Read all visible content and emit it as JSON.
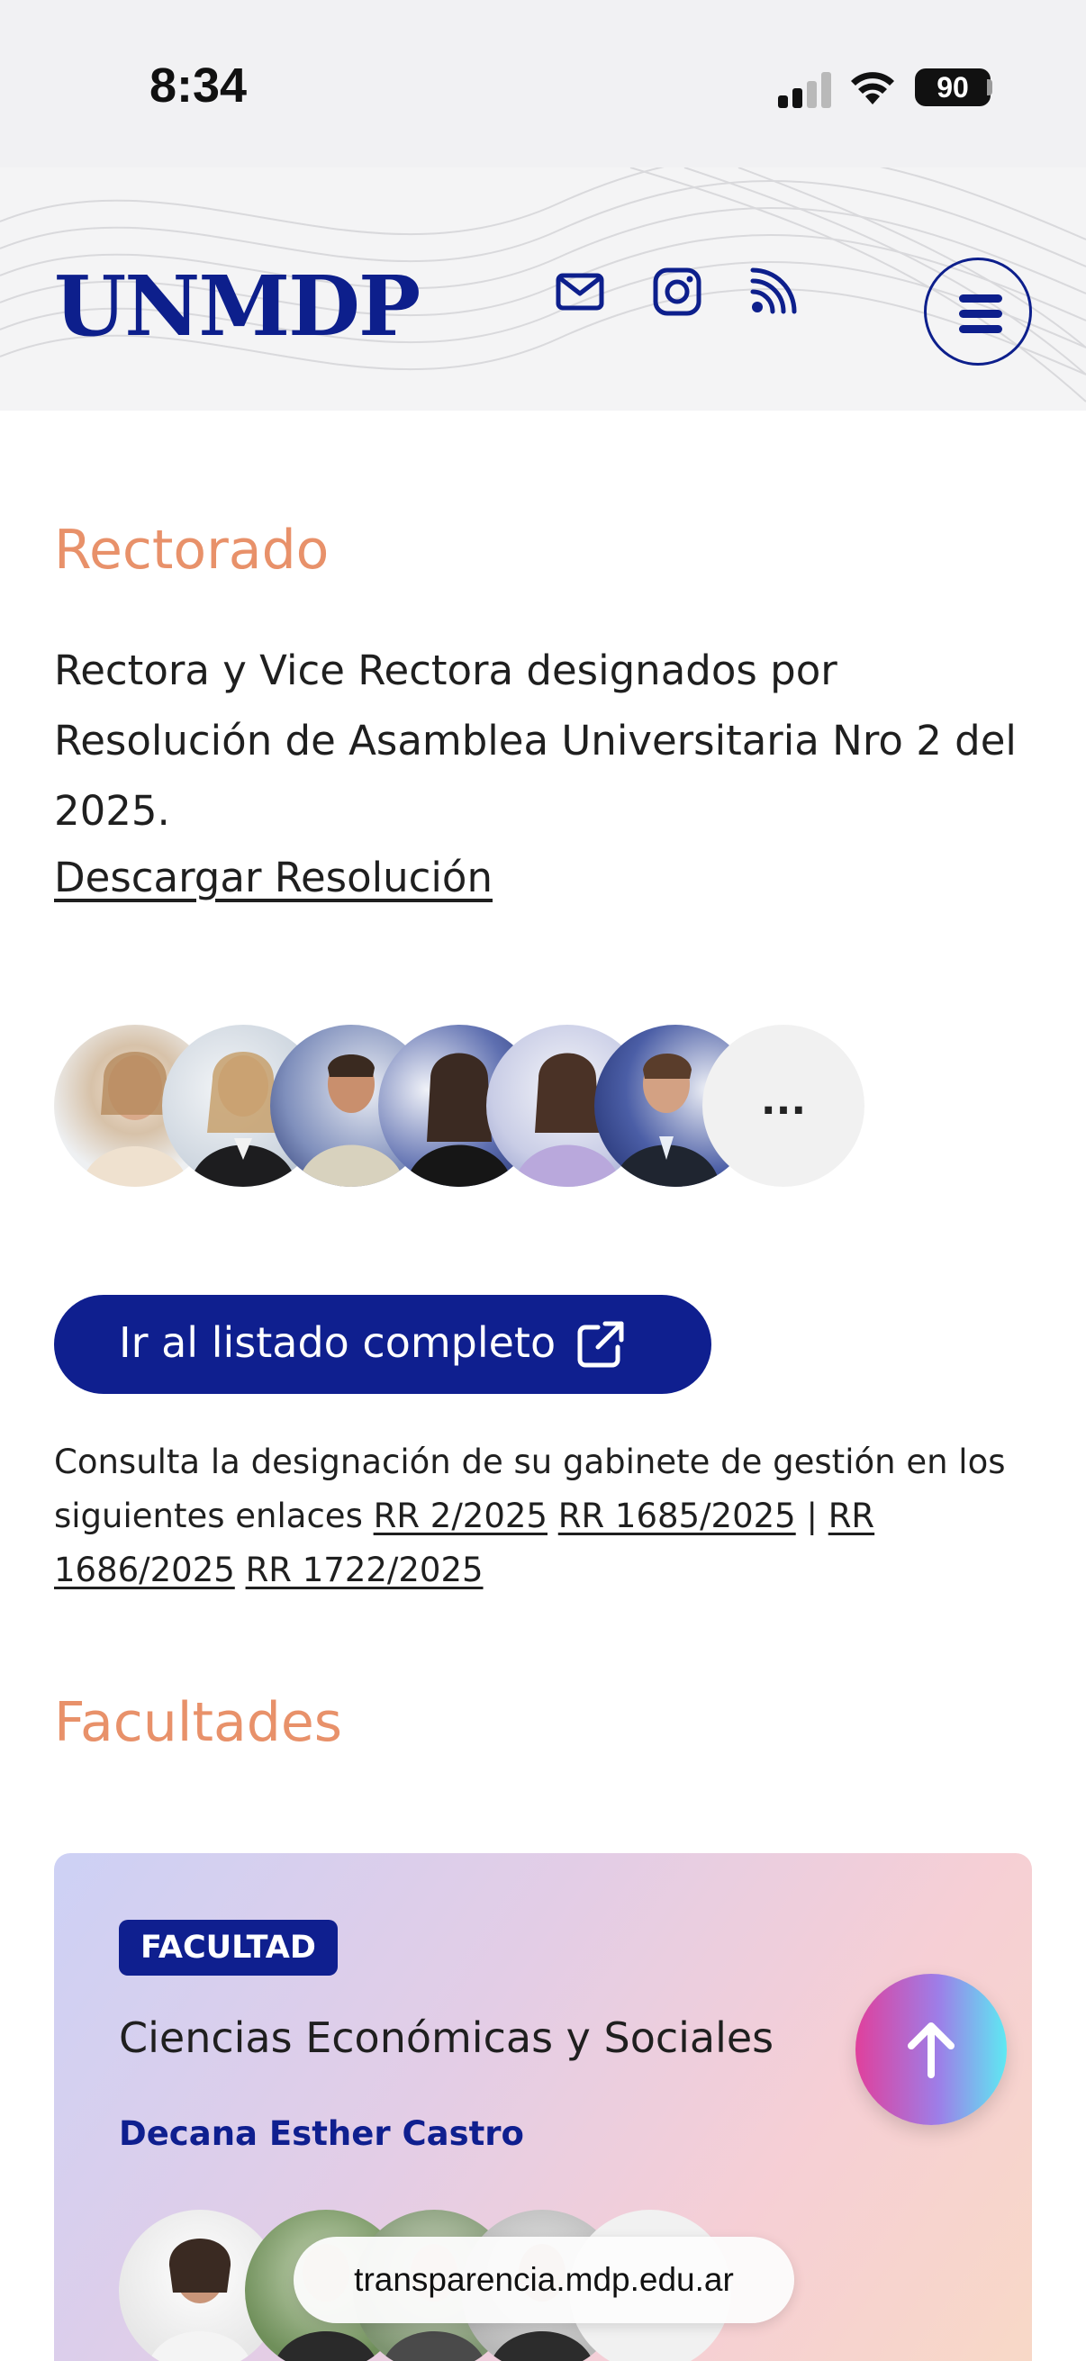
{
  "status_bar": {
    "time": "8:34",
    "battery": "90"
  },
  "header": {
    "logo": "UNMDP",
    "icons": [
      "mail-icon",
      "instagram-icon",
      "rss-icon",
      "menu-icon"
    ]
  },
  "rectorado": {
    "title": "Rectorado",
    "description": "Rectora y Vice Rectora designados por Resolución de Asamblea Universitaria Nro 2 del 2025.",
    "download_link": "Descargar Resolución",
    "more_label": "...",
    "cta_label": "Ir al listado completo",
    "consult_text": "Consulta la designación de su gabinete de gestión en los siguientes enlaces",
    "links": [
      "RR 2/2025",
      "RR 1685/2025",
      "RR 1686/2025",
      "RR 1722/2025"
    ],
    "separator": "|"
  },
  "facultades": {
    "title": "Facultades",
    "card": {
      "badge": "FACULTAD",
      "name": "Ciencias Económicas y Sociales",
      "dean": "Decana Esther Castro"
    }
  },
  "browser": {
    "url": "transparencia.mdp.edu.ar"
  },
  "colors": {
    "brand": "#0f1f8f",
    "accent": "#e8916a"
  }
}
